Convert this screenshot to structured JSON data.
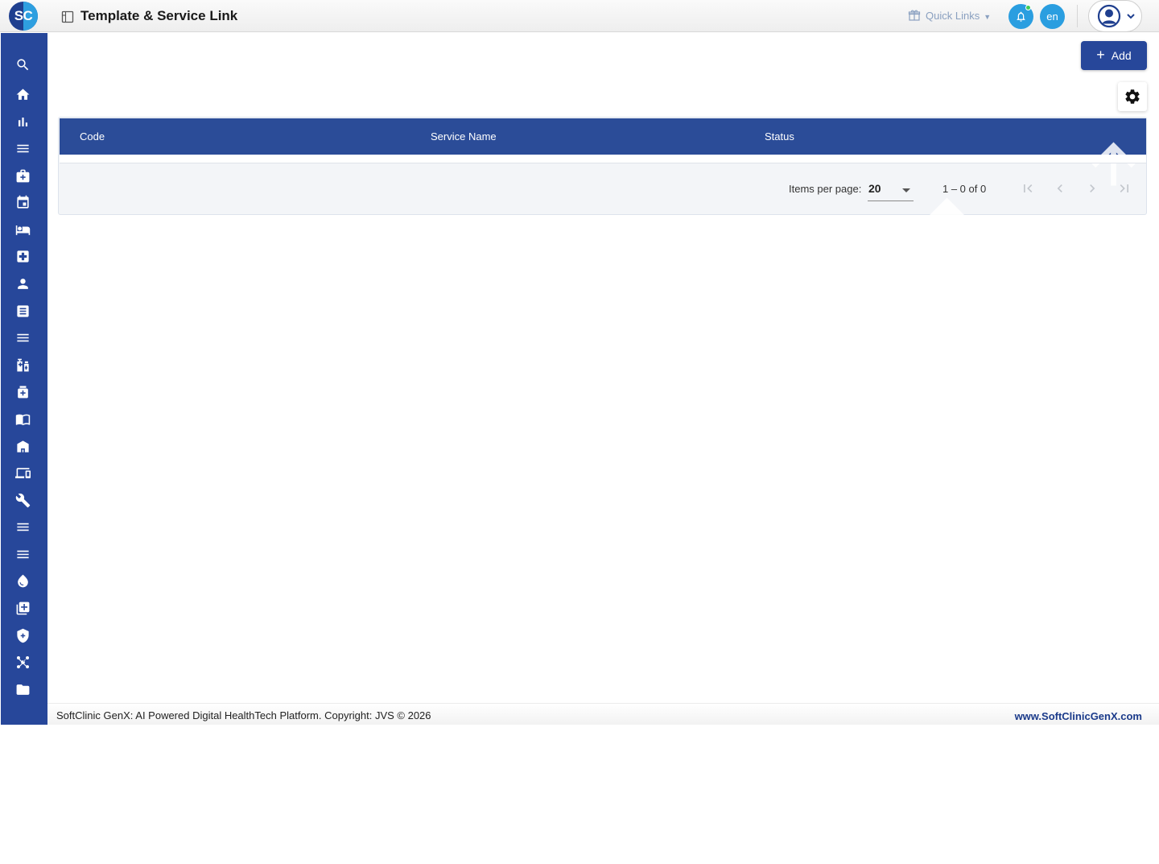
{
  "app": {
    "logo_text": "SC",
    "page_title": "Template & Service Link"
  },
  "header": {
    "quick_links_label": "Quick Links",
    "language_label": "en",
    "notification_indicator": "online-dot"
  },
  "sidebar": {
    "items": [
      {
        "icon": "search-icon"
      },
      {
        "icon": "home-icon"
      },
      {
        "icon": "bar-chart-icon"
      },
      {
        "icon": "menu-icon"
      },
      {
        "icon": "medical-bag-icon"
      },
      {
        "icon": "calendar-icon"
      },
      {
        "icon": "bed-icon"
      },
      {
        "icon": "medical-cross-icon"
      },
      {
        "icon": "person-icon"
      },
      {
        "icon": "document-list-icon"
      },
      {
        "icon": "menu-icon"
      },
      {
        "icon": "pharmacy-icon"
      },
      {
        "icon": "medicine-box-icon"
      },
      {
        "icon": "book-icon"
      },
      {
        "icon": "store-icon"
      },
      {
        "icon": "devices-icon"
      },
      {
        "icon": "wrench-icon"
      },
      {
        "icon": "menu-icon"
      },
      {
        "icon": "menu-icon"
      },
      {
        "icon": "blood-drop-icon"
      },
      {
        "icon": "add-library-icon"
      },
      {
        "icon": "shield-icon"
      },
      {
        "icon": "hub-icon"
      },
      {
        "icon": "folder-icon"
      }
    ]
  },
  "toolbar": {
    "add_label": "Add"
  },
  "table": {
    "columns": [
      "Code",
      "Service Name",
      "Status"
    ],
    "rows": []
  },
  "pagination": {
    "items_per_page_label": "Items per page:",
    "items_per_page_value": "20",
    "range_label": "1 – 0 of 0"
  },
  "footer": {
    "copyright": "SoftClinic GenX: AI Powered Digital HealthTech Platform. Copyright: JVS © 2026",
    "website": "www.SoftClinicGenX.com"
  },
  "colors": {
    "primary": "#27479a",
    "header_row": "#2b4c98",
    "accent": "#2a9ee0",
    "status_online": "#3ccc58"
  }
}
